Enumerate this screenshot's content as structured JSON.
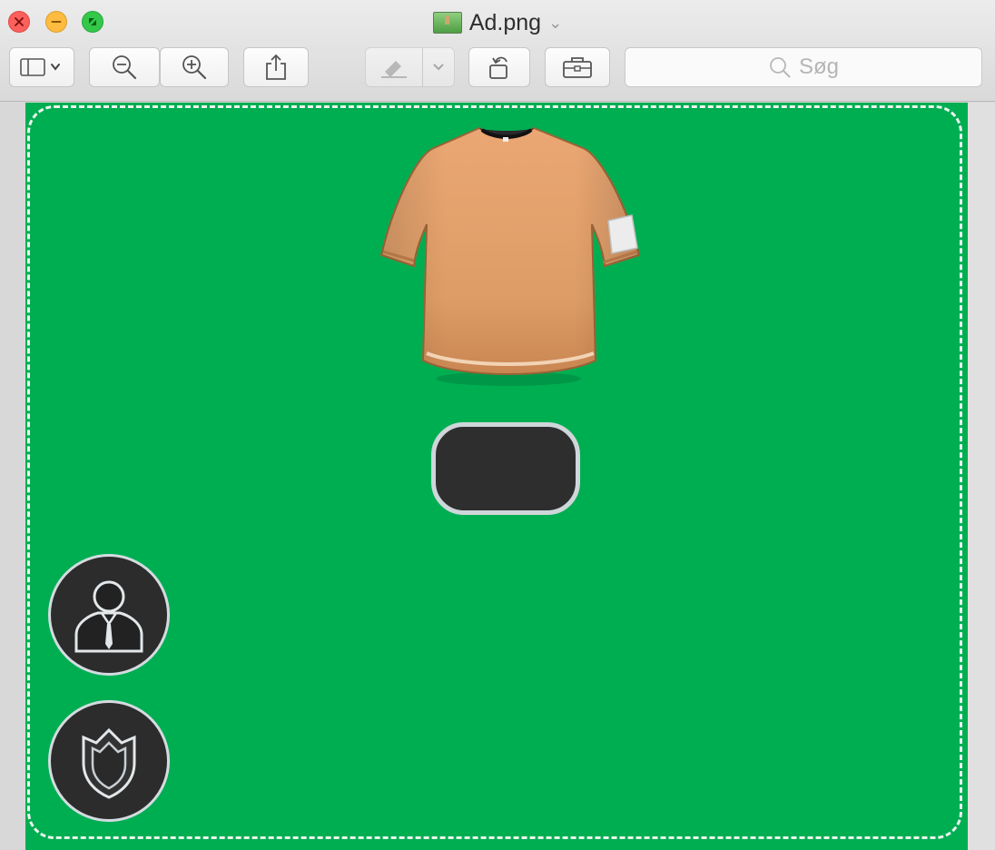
{
  "window": {
    "title": "Ad.png",
    "title_chevron": "chevron-down-icon"
  },
  "toolbar": {
    "items": [
      {
        "name": "sidebar-toggle-button",
        "icon": "sidebar-icon"
      },
      {
        "name": "zoom-out-button",
        "icon": "zoom-out-icon"
      },
      {
        "name": "zoom-in-button",
        "icon": "zoom-in-icon"
      },
      {
        "name": "share-button",
        "icon": "share-icon"
      },
      {
        "name": "markup-button",
        "icon": "pen-icon"
      },
      {
        "name": "rotate-button",
        "icon": "rotate-icon"
      },
      {
        "name": "toolbox-button",
        "icon": "toolbox-icon"
      }
    ],
    "search": {
      "placeholder": "Søg"
    }
  },
  "image": {
    "background_color": "#00ae52",
    "shirt_color": "#e2a06a",
    "pill_color": "#2e2e2e",
    "icons": [
      "tshirt-icon",
      "manager-icon",
      "shield-icon"
    ]
  }
}
